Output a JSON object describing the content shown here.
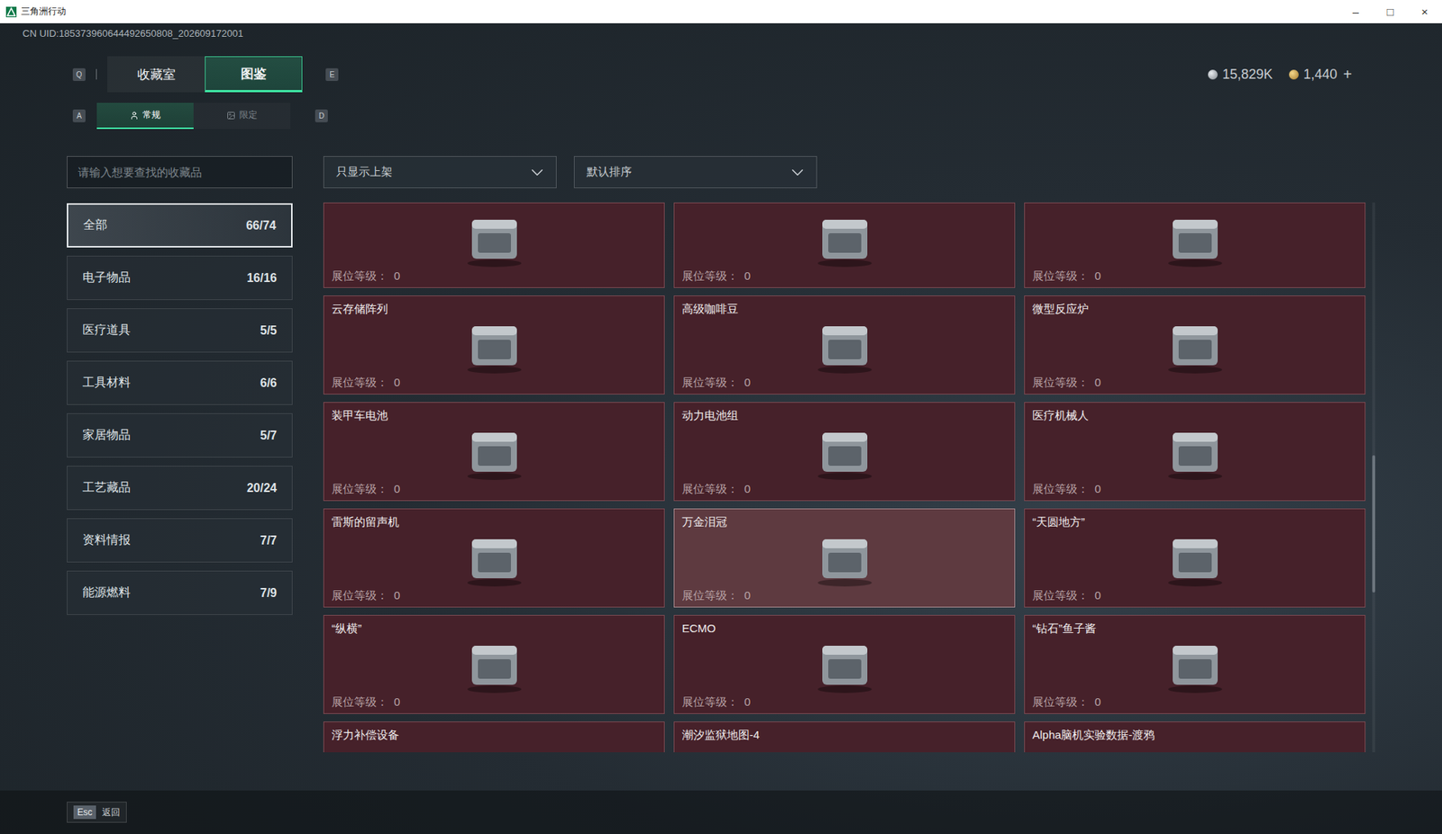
{
  "window": {
    "title": "三角洲行动",
    "controls": [
      "–",
      "□",
      "×"
    ]
  },
  "uid": "CN UID:185373960644492650808_202609172001",
  "currency": [
    {
      "amount": "15,829K",
      "kind": "silver",
      "add": ""
    },
    {
      "amount": "1,440",
      "kind": "gold",
      "add": "+"
    }
  ],
  "tabs": {
    "prev_key": "Q",
    "next_key": "E",
    "items": [
      {
        "label": "收藏室",
        "selected": false
      },
      {
        "label": "图鉴",
        "selected": true
      }
    ]
  },
  "subtabs": {
    "prev_key": "A",
    "next_key": "D",
    "items": [
      {
        "label": "常规",
        "selected": true,
        "kind": "regular"
      },
      {
        "label": "限定",
        "selected": false,
        "kind": "limited"
      }
    ]
  },
  "search": {
    "placeholder": "请输入想要查找的收藏品"
  },
  "filters": [
    {
      "value": "只显示上架"
    },
    {
      "value": "默认排序"
    }
  ],
  "sidebar": {
    "items": [
      {
        "label": "全部",
        "count": "66/74",
        "selected": true
      },
      {
        "label": "电子物品",
        "count": "16/16",
        "selected": false
      },
      {
        "label": "医疗道具",
        "count": "5/5",
        "selected": false
      },
      {
        "label": "工具材料",
        "count": "6/6",
        "selected": false
      },
      {
        "label": "家居物品",
        "count": "5/7",
        "selected": false
      },
      {
        "label": "工艺藏品",
        "count": "20/24",
        "selected": false
      },
      {
        "label": "资料情报",
        "count": "7/7",
        "selected": false
      },
      {
        "label": "能源燃料",
        "count": "7/9",
        "selected": false
      }
    ]
  },
  "grid": {
    "level_label": "展位等级：",
    "items": [
      {
        "name": "",
        "display_level": "0",
        "highlighted": false
      },
      {
        "name": "",
        "display_level": "0",
        "highlighted": false
      },
      {
        "name": "",
        "display_level": "0",
        "highlighted": false
      },
      {
        "name": "云存储阵列",
        "display_level": "0",
        "highlighted": false
      },
      {
        "name": "高级咖啡豆",
        "display_level": "0",
        "highlighted": false
      },
      {
        "name": "微型反应炉",
        "display_level": "0",
        "highlighted": false
      },
      {
        "name": "装甲车电池",
        "display_level": "0",
        "highlighted": false
      },
      {
        "name": "动力电池组",
        "display_level": "0",
        "highlighted": false
      },
      {
        "name": "医疗机械人",
        "display_level": "0",
        "highlighted": false
      },
      {
        "name": "雷斯的留声机",
        "display_level": "0",
        "highlighted": false
      },
      {
        "name": "万金泪冠",
        "display_level": "0",
        "highlighted": true
      },
      {
        "name": "“天圆地方”",
        "display_level": "0",
        "highlighted": false
      },
      {
        "name": "“纵横”",
        "display_level": "0",
        "highlighted": false
      },
      {
        "name": "ECMO",
        "display_level": "0",
        "highlighted": false
      },
      {
        "name": "“钻石”鱼子酱",
        "display_level": "0",
        "highlighted": false
      },
      {
        "name": "浮力补偿设备",
        "display_level": "",
        "highlighted": false
      },
      {
        "name": "潮汐监狱地图-4",
        "display_level": "",
        "highlighted": false
      },
      {
        "name": "Alpha脑机实验数据-渡鸦",
        "display_level": "",
        "highlighted": false
      }
    ]
  },
  "scrollbar": {
    "offset": 0.46,
    "size": 0.25
  },
  "bottom_bar": {
    "key": "Esc",
    "label": "返回"
  }
}
